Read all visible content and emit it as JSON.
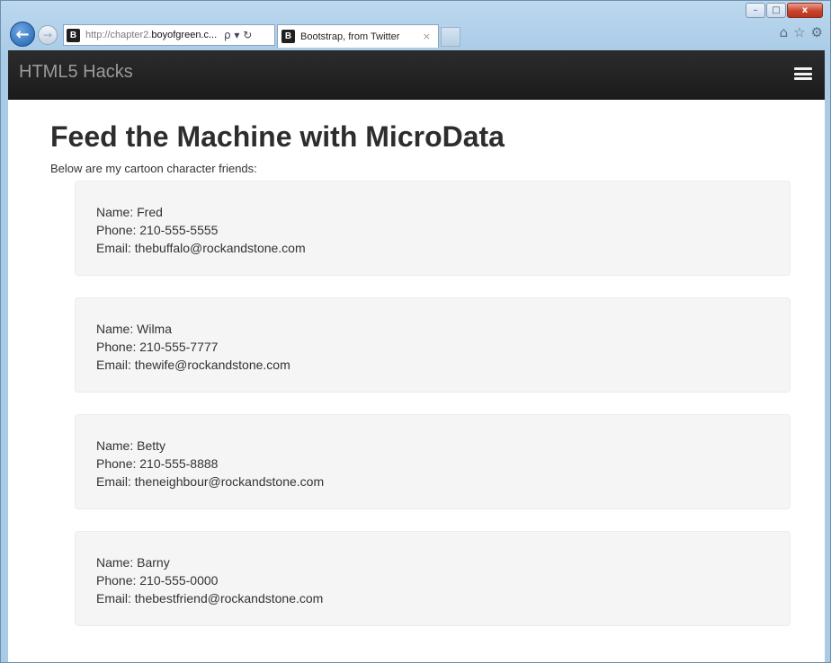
{
  "browser": {
    "url_prefix": "http://chapter2.",
    "url_domain": "boyofgreen.c...",
    "url_actions": "ρ ▾ ↻",
    "favicon_letter": "B",
    "tab_title": "Bootstrap, from Twitter",
    "tab_close": "×",
    "back_label": "←",
    "forward_label": "→",
    "right_icons": [
      "home-icon",
      "star-icon",
      "gear-icon"
    ],
    "window_controls": {
      "minimize": "–",
      "maximize": "□",
      "close": "x"
    }
  },
  "site": {
    "brand": "HTML5 Hacks",
    "menu_icon": "hamburger-menu-icon"
  },
  "page": {
    "title": "Feed the Machine with MicroData",
    "intro": "Below are my cartoon character friends:"
  },
  "friends": [
    {
      "name": "Name: Fred",
      "phone": "Phone: 210-555-5555",
      "email": "Email: thebuffalo@rockandstone.com"
    },
    {
      "name": "Name: Wilma",
      "phone": "Phone: 210-555-7777",
      "email": "Email: thewife@rockandstone.com"
    },
    {
      "name": "Name: Betty",
      "phone": "Phone: 210-555-8888",
      "email": "Email: theneighbour@rockandstone.com"
    },
    {
      "name": "Name: Barny",
      "phone": "Phone: 210-555-0000",
      "email": "Email: thebestfriend@rockandstone.com"
    }
  ],
  "colors": {
    "navbar": "#222222",
    "card_background": "#f5f5f5",
    "brand_text": "#9a9a9a"
  }
}
